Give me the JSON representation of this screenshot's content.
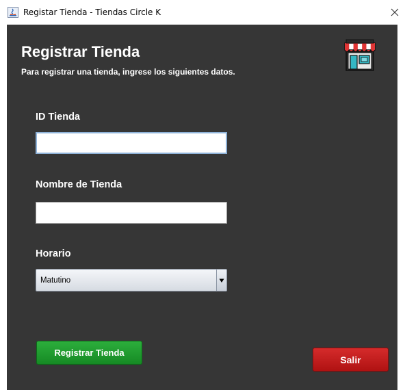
{
  "window": {
    "title": "Registar Tienda - Tiendas Circle K",
    "close_icon": "close-icon",
    "app_icon": "java-app-icon"
  },
  "form": {
    "heading": "Registrar Tienda",
    "subheading": "Para registrar una tienda, ingrese los siguientes datos.",
    "store_icon": "store-icon",
    "id_label": "ID Tienda",
    "id_value": "",
    "name_label": "Nombre de Tienda",
    "name_value": "",
    "schedule_label": "Horario",
    "schedule_selected": "Matutino"
  },
  "buttons": {
    "register_label": "Registrar Tienda",
    "exit_label": "Salir"
  },
  "colors": {
    "panel_bg": "#363636",
    "register_green": "#1f9d2f",
    "exit_red": "#c41a1a"
  }
}
